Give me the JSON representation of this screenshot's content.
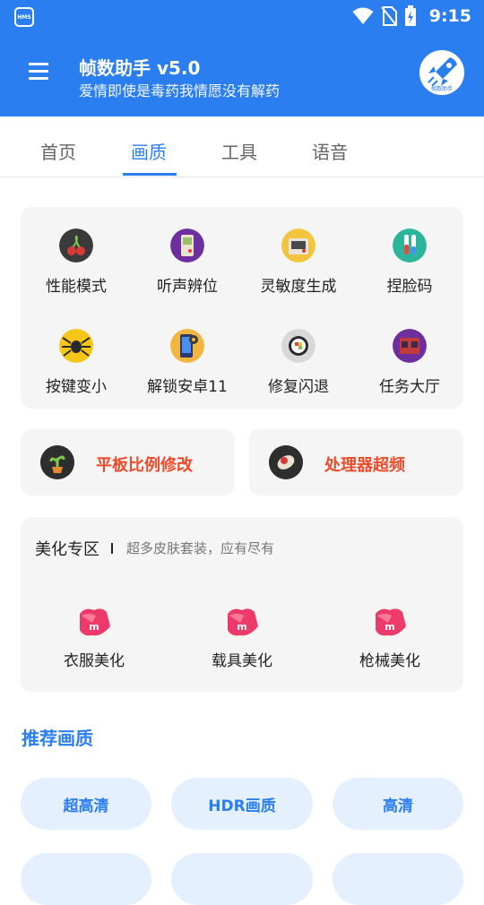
{
  "status_bar": {
    "hms_label": "HMS",
    "time": "9:15"
  },
  "header": {
    "title": "帧数助手 v5.0",
    "subtitle": "爱情即使是毒药我情愿没有解药",
    "avatar_text": "帧数助手",
    "color": "#2b7ef0"
  },
  "tabs": [
    {
      "label": "首页"
    },
    {
      "label": "画质"
    },
    {
      "label": "工具"
    },
    {
      "label": "语音"
    }
  ],
  "active_tab": "画质",
  "grid": [
    {
      "label": "性能模式",
      "icon": "cherry-icon"
    },
    {
      "label": "听声辨位",
      "icon": "gameboy-icon"
    },
    {
      "label": "灵敏度生成",
      "icon": "camera-icon"
    },
    {
      "label": "捏脸码",
      "icon": "test-tube-icon"
    },
    {
      "label": "按键变小",
      "icon": "spider-icon"
    },
    {
      "label": "解锁安卓11",
      "icon": "phone-gear-icon"
    },
    {
      "label": "修复闪退",
      "icon": "sushi-icon"
    },
    {
      "label": "任务大厅",
      "icon": "cinema-icon"
    }
  ],
  "features": [
    {
      "label": "平板比例修改",
      "icon": "plant-icon"
    },
    {
      "label": "处理器超频",
      "icon": "chip-icon"
    }
  ],
  "beauty": {
    "title": "美化专区",
    "subtitle": "超多皮肤套装，应有尽有",
    "items": [
      {
        "label": "衣服美化"
      },
      {
        "label": "载具美化"
      },
      {
        "label": "枪械美化"
      }
    ]
  },
  "recommend": {
    "title": "推荐画质",
    "options": [
      {
        "label": "超高清"
      },
      {
        "label": "HDR画质"
      },
      {
        "label": "高清"
      }
    ]
  }
}
